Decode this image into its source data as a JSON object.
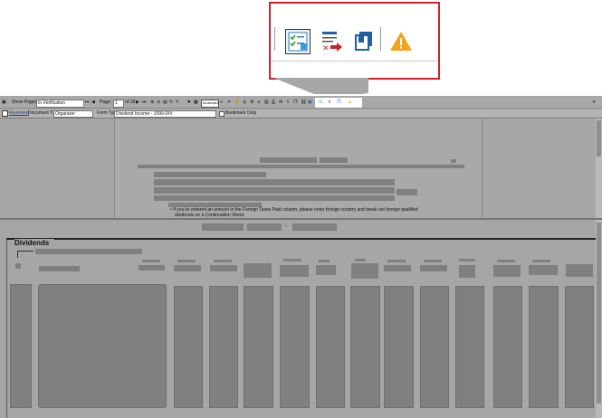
{
  "toolbar": {
    "show_pages_label": "Show Page(s)",
    "show_pages_value": "In Verification",
    "page_label": "Page:",
    "page_value": "1",
    "page_total": "of 18",
    "bookmark_label": "bookmark"
  },
  "docbar": {
    "reviewed_label": "Reviewed",
    "document_type_label": "Document Type",
    "document_type_value": "Organizer",
    "form_type_label": "Form Type",
    "form_type_value": "Dividend Income - 1099-DIV",
    "bookmark_only_label": "Bookmark Only"
  },
  "document": {
    "bullet_text_line1": "If you've entered an amount in the Foreign Taxes Paid column, please enter foreign country and break out foreign qualified",
    "bullet_text_line2": "dividends on a Continuation Sheet."
  },
  "form": {
    "section_title": "Dividends",
    "separator": "-"
  },
  "callout": {
    "icons": [
      "verify-checklist-icon",
      "reject-mark-icon",
      "bookmark-pages-icon",
      "warning-icon"
    ]
  },
  "colors": {
    "accent_red": "#d21f2b",
    "redaction_gray": "#808080",
    "canvas_gray": "#a6a6a6"
  }
}
